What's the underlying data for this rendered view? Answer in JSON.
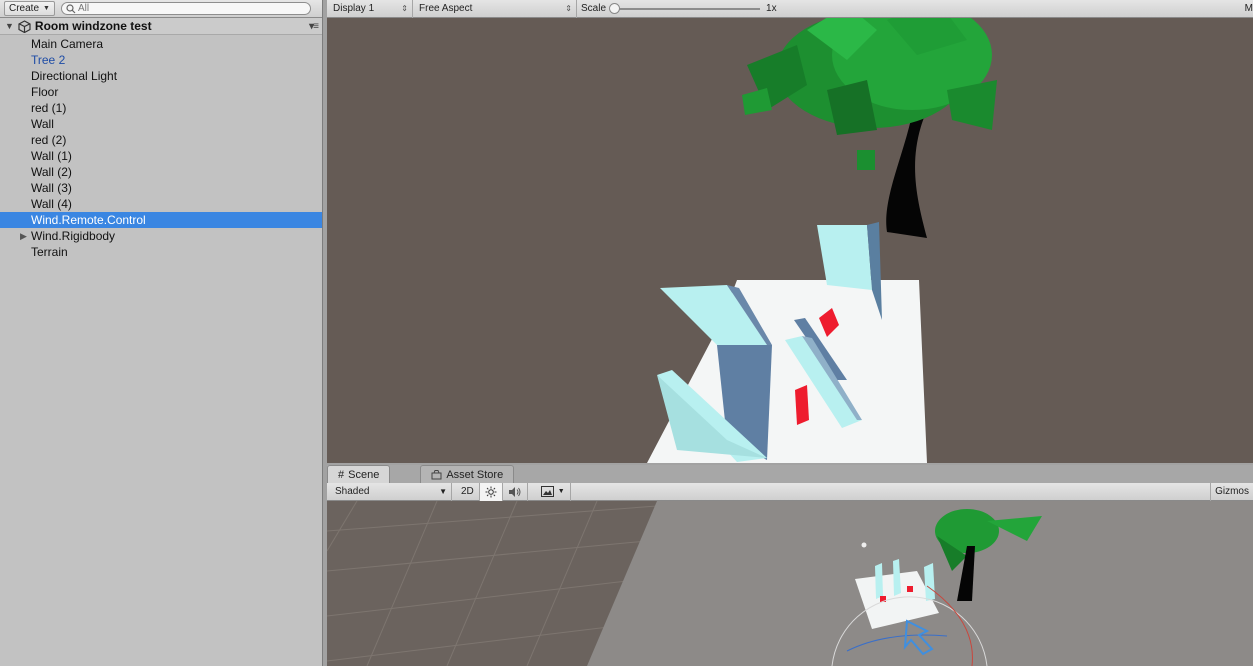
{
  "hierarchy": {
    "create_label": "Create",
    "search_placeholder": "All",
    "scene_name": "Room windzone test",
    "items": [
      {
        "label": "Main Camera"
      },
      {
        "label": "Tree 2"
      },
      {
        "label": "Directional Light"
      },
      {
        "label": "Floor"
      },
      {
        "label": "red (1)"
      },
      {
        "label": "Wall"
      },
      {
        "label": "red (2)"
      },
      {
        "label": "Wall (1)"
      },
      {
        "label": "Wall (2)"
      },
      {
        "label": "Wall (3)"
      },
      {
        "label": "Wall (4)"
      },
      {
        "label": "Wind.Remote.Control"
      },
      {
        "label": "Wind.Rigidbody"
      },
      {
        "label": "Terrain"
      }
    ]
  },
  "game": {
    "display_label": "Display 1",
    "aspect_label": "Free Aspect",
    "scale_label": "Scale",
    "scale_value": "1x",
    "right_label": "M"
  },
  "scene": {
    "tab_scene": "Scene",
    "tab_asset_store": "Asset Store",
    "shading_mode": "Shaded",
    "mode_2d": "2D",
    "gizmos_label": "Gizmos"
  },
  "colors": {
    "selection": "#3a86e2",
    "prefab_text": "#1e4ca6",
    "game_bg": "#655b55",
    "leaf_green": "#1f9a34",
    "wall_cyan": "#b8f0f0",
    "red_block": "#ee1c2e"
  },
  "icons": {
    "search": "search-icon",
    "unity_scene": "unity-logo-icon",
    "sun": "sun-icon",
    "speaker": "speaker-icon",
    "image": "image-icon",
    "grid": "grid-icon",
    "store": "store-icon"
  }
}
